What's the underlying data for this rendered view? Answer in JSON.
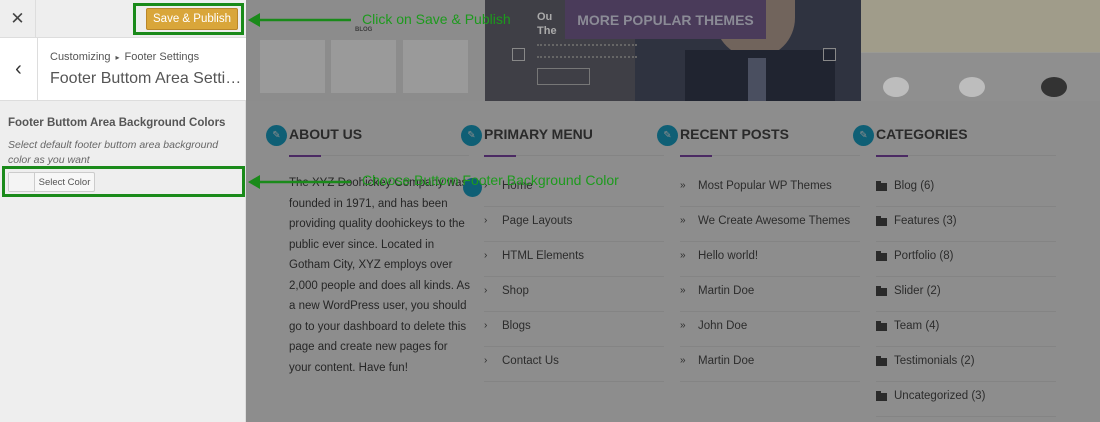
{
  "customizer": {
    "close_icon": "close-icon",
    "save_label": "Save & Publish",
    "breadcrumb": [
      "Customizing",
      "Footer Settings"
    ],
    "section_title": "Footer Buttom Area Settings",
    "control_title": "Footer Buttom Area Background Colors",
    "control_desc": "Select default footer buttom area background color as you want",
    "color_button_label": "Select Color"
  },
  "preview": {
    "banner": {
      "blog_label": "BLOG",
      "mid_heading_1": "Ou",
      "mid_heading_2": "The",
      "more_themes": "MORE POPULAR THEMES"
    },
    "widgets": {
      "about": {
        "title": "ABOUT US",
        "text": "The XYZ Doohickey Company was founded in 1971, and has been providing quality doohickeys to the public ever since. Located in Gotham City, XYZ employs over 2,000 people and does all kinds. As a new WordPress user, you should go to your dashboard to delete this page and create new pages for your content. Have fun!"
      },
      "primary_menu": {
        "title": "PRIMARY MENU",
        "items": [
          "Home",
          "Page Layouts",
          "HTML Elements",
          "Shop",
          "Blogs",
          "Contact Us"
        ]
      },
      "recent_posts": {
        "title": "RECENT POSTS",
        "items": [
          "Most Popular WP Themes",
          "We Create Awesome Themes",
          "Hello world!",
          "Martin Doe",
          "John Doe",
          "Martin Doe"
        ]
      },
      "categories": {
        "title": "CATEGORIES",
        "items": [
          "Blog (6)",
          "Features (3)",
          "Portfolio (8)",
          "Slider (2)",
          "Team (4)",
          "Testimonials (2)",
          "Uncategorized (3)"
        ]
      }
    }
  },
  "annotations": {
    "save_callout": "Click on Save & Publish",
    "color_callout": "Choose Buttom Footer Background Color"
  },
  "colors": {
    "accent_green": "#1a8a1a",
    "save_button": "#d9a63a",
    "widget_icon": "#0f5f75"
  }
}
